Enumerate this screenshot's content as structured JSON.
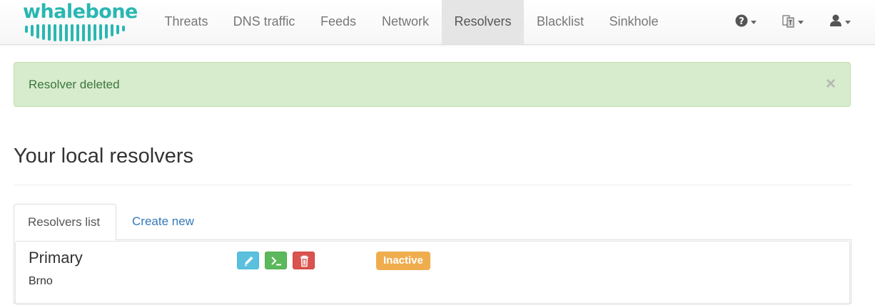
{
  "brand": {
    "name": "whalebone",
    "color": "#2ab7b2"
  },
  "nav": {
    "items": [
      {
        "label": "Threats"
      },
      {
        "label": "DNS traffic"
      },
      {
        "label": "Feeds"
      },
      {
        "label": "Network"
      },
      {
        "label": "Resolvers",
        "active": true
      },
      {
        "label": "Blacklist"
      },
      {
        "label": "Sinkhole"
      }
    ],
    "right_icons": [
      "help-icon",
      "language-icon",
      "user-icon"
    ]
  },
  "alert": {
    "text": "Resolver deleted",
    "close": "×",
    "color": "#3c763d"
  },
  "page": {
    "title": "Your local resolvers"
  },
  "tabs": [
    {
      "label": "Resolvers list",
      "active": true
    },
    {
      "label": "Create new"
    }
  ],
  "resolvers": [
    {
      "name": "Primary",
      "location": "Brno",
      "actions": [
        "pencil-icon",
        "terminal-icon",
        "trash-icon"
      ],
      "status": "Inactive",
      "status_color": "#f0ad4e"
    }
  ]
}
